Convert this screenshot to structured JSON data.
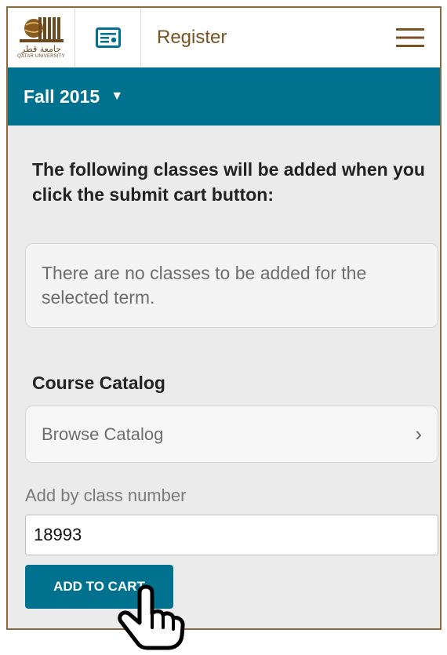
{
  "header": {
    "logo_arabic": "جامعة قطر",
    "logo_english": "QATAR UNIVERSITY",
    "title": "Register",
    "menu_icon": "hamburger-icon",
    "register_icon": "id-card-icon"
  },
  "term": {
    "label": "Fall 2015",
    "caret": "▼"
  },
  "cart": {
    "heading": "The following classes will be added when you click the submit cart button:",
    "empty_message": "There are no classes to be added for the selected term."
  },
  "catalog": {
    "label": "Course Catalog",
    "browse_label": "Browse Catalog",
    "chevron": "›"
  },
  "add_by_number": {
    "label": "Add by class number",
    "value": "18993",
    "button_label": "ADD TO CART"
  },
  "colors": {
    "accent": "#007290",
    "brand_brown": "#7a5220",
    "background": "#ebebeb"
  }
}
